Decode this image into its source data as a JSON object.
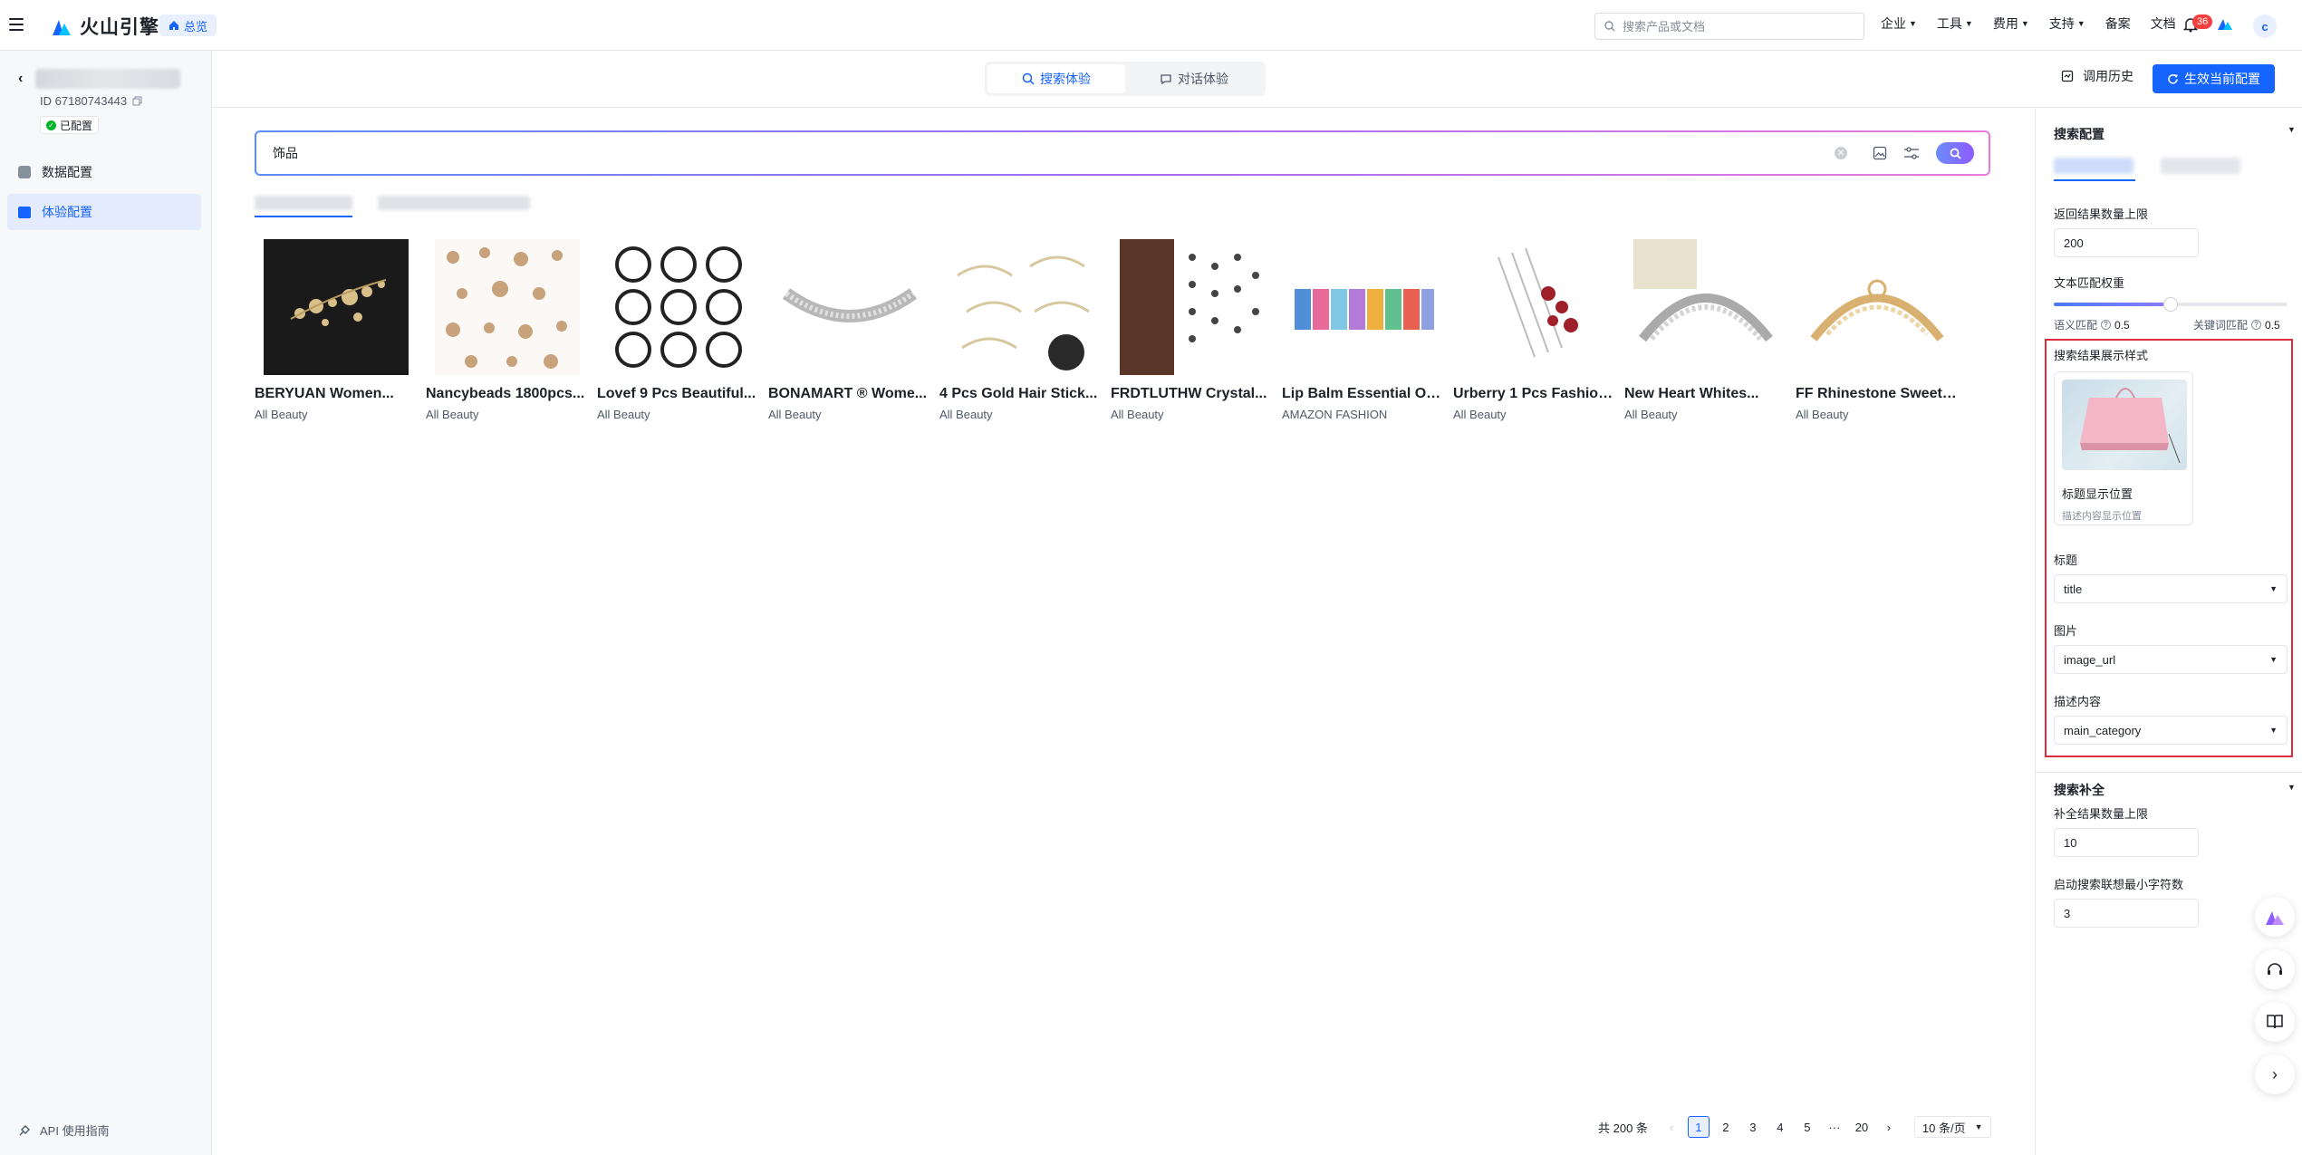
{
  "brand": {
    "name": "火山引擎"
  },
  "topbar": {
    "home_label": "总览",
    "search_placeholder": "搜索产品或文档",
    "nav": [
      "企业",
      "工具",
      "费用",
      "支持"
    ],
    "nav_plain": [
      "备案",
      "文档"
    ],
    "notification_count": "36",
    "avatar_letter": "c"
  },
  "sidebar": {
    "project_id": "ID 67180743443",
    "status": "已配置",
    "items": [
      {
        "label": "数据配置",
        "icon": "database-icon"
      },
      {
        "label": "体验配置",
        "icon": "experience-icon"
      }
    ],
    "api_guide": "API 使用指南"
  },
  "header": {
    "tabs": [
      {
        "label": "搜索体验",
        "icon": "search-icon"
      },
      {
        "label": "对话体验",
        "icon": "chat-icon"
      }
    ],
    "history_label": "调用历史",
    "apply_label": "生效当前配置"
  },
  "search": {
    "query": "饰品"
  },
  "products": [
    {
      "title": "BERYUAN Women...",
      "category": "All Beauty"
    },
    {
      "title": "Nancybeads 1800pcs...",
      "category": "All Beauty"
    },
    {
      "title": "Lovef 9 Pcs Beautiful...",
      "category": "All Beauty"
    },
    {
      "title": "BONAMART ® Wome...",
      "category": "All Beauty"
    },
    {
      "title": "4 Pcs Gold Hair Stick...",
      "category": "All Beauty"
    },
    {
      "title": "FRDTLUTHW Crystal...",
      "category": "All Beauty"
    },
    {
      "title": "Lip Balm Essential Oil...",
      "category": "AMAZON FASHION"
    },
    {
      "title": "Urberry 1 Pcs Fashion...",
      "category": "All Beauty"
    },
    {
      "title": "New Heart Whites...",
      "category": "All Beauty"
    },
    {
      "title": "FF Rhinestone Sweet ...",
      "category": "All Beauty"
    }
  ],
  "pagination": {
    "total": "共 200 条",
    "pages": [
      "1",
      "2",
      "3",
      "4",
      "5",
      "···",
      "20"
    ],
    "current": "1",
    "page_size": "10 条/页"
  },
  "panel": {
    "search_config_title": "搜索配置",
    "result_limit_label": "返回结果数量上限",
    "result_limit_value": "200",
    "weight_label": "文本匹配权重",
    "semantic_label": "语义匹配",
    "semantic_value": "0.5",
    "keyword_label": "关键词匹配",
    "keyword_value": "0.5",
    "weight_fraction": 0.5,
    "display_style_label": "搜索结果展示样式",
    "preview_title": "标题显示位置",
    "preview_desc": "描述内容显示位置",
    "title_field_label": "标题",
    "title_field_value": "title",
    "image_field_label": "图片",
    "image_field_value": "image_url",
    "desc_field_label": "描述内容",
    "desc_field_value": "main_category",
    "completion_title": "搜索补全",
    "completion_limit_label": "补全结果数量上限",
    "completion_limit_value": "10",
    "min_chars_label": "启动搜索联想最小字符数",
    "min_chars_value": "3"
  },
  "colors": {
    "accent": "#1664ff",
    "highlight_box": "#e02c3f"
  }
}
